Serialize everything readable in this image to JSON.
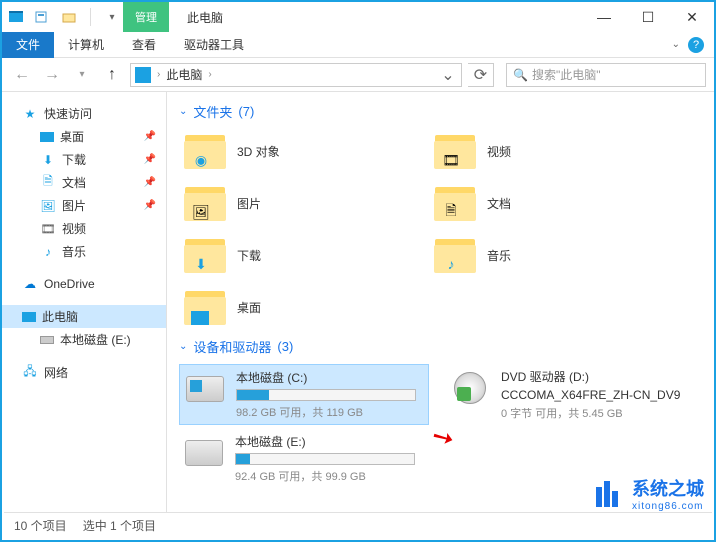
{
  "titlebar": {
    "context_tab": "管理",
    "title": "此电脑"
  },
  "ribbon": {
    "file": "文件",
    "computer": "计算机",
    "view": "查看",
    "drive_tools": "驱动器工具"
  },
  "address": {
    "breadcrumb": "此电脑",
    "search_placeholder": "搜索\"此电脑\""
  },
  "sidebar": {
    "quick_access": "快速访问",
    "desktop": "桌面",
    "downloads": "下载",
    "documents": "文档",
    "pictures": "图片",
    "videos": "视频",
    "music": "音乐",
    "onedrive": "OneDrive",
    "this_pc": "此电脑",
    "local_e": "本地磁盘 (E:)",
    "network": "网络"
  },
  "groups": {
    "folders": {
      "label": "文件夹",
      "count": "(7)"
    },
    "devices": {
      "label": "设备和驱动器",
      "count": "(3)"
    }
  },
  "folders": {
    "objects3d": "3D 对象",
    "videos": "视频",
    "pictures": "图片",
    "documents": "文档",
    "downloads": "下载",
    "music": "音乐",
    "desktop": "桌面"
  },
  "drives": {
    "c": {
      "name": "本地磁盘 (C:)",
      "stats": "98.2 GB 可用，共 119 GB",
      "fill_pct": 18
    },
    "d": {
      "name": "DVD 驱动器 (D:)",
      "label": "CCCOMA_X64FRE_ZH-CN_DV9",
      "stats": "0 字节 可用，共 5.45 GB"
    },
    "e": {
      "name": "本地磁盘 (E:)",
      "stats": "92.4 GB 可用，共 99.9 GB",
      "fill_pct": 8
    }
  },
  "status": {
    "items": "10 个项目",
    "selected": "选中 1 个项目"
  },
  "watermark": {
    "main": "系统之城",
    "sub": "xitong86.com"
  }
}
